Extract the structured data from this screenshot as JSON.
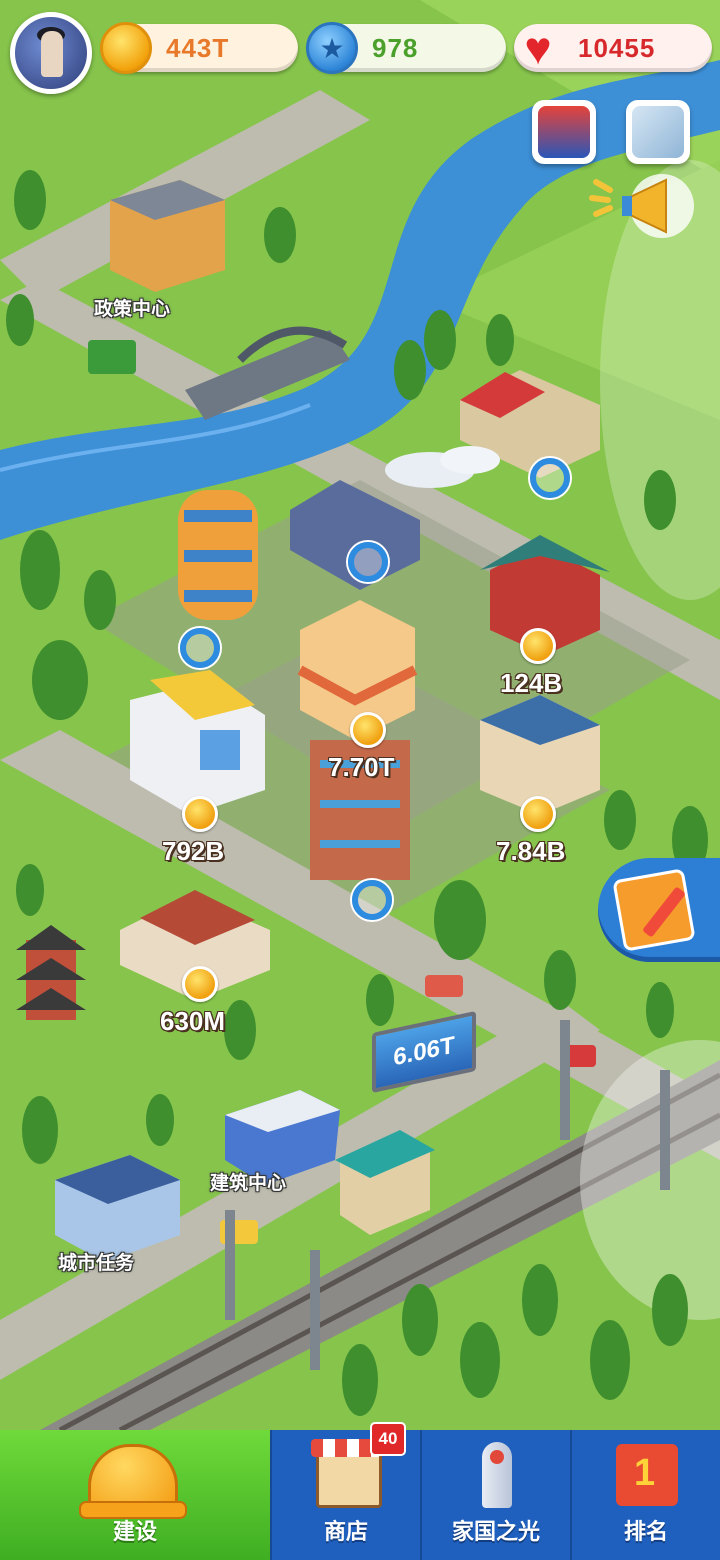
{
  "hud": {
    "coins": "443T",
    "stars": "978",
    "hearts": "10455"
  },
  "map": {
    "labels": {
      "policy_center": "政策中心",
      "building_center": "建筑中心",
      "city_tasks": "城市任务"
    },
    "earnings": {
      "temple": "124B",
      "shop_center": "7.70T",
      "library": "792B",
      "apartment": "7.84B",
      "courtyard_house": "630M"
    },
    "billboard": "6.06T"
  },
  "nav": {
    "build": "建设",
    "shop": "商店",
    "shop_badge": "40",
    "home_light": "家国之光",
    "ranking": "排名"
  },
  "colors": {
    "grass": "#7fc04a",
    "river": "#3d8fd6",
    "road": "#b9b7a8",
    "nav_bg": "#1f5fbe",
    "nav_active": "#4fc02a"
  }
}
